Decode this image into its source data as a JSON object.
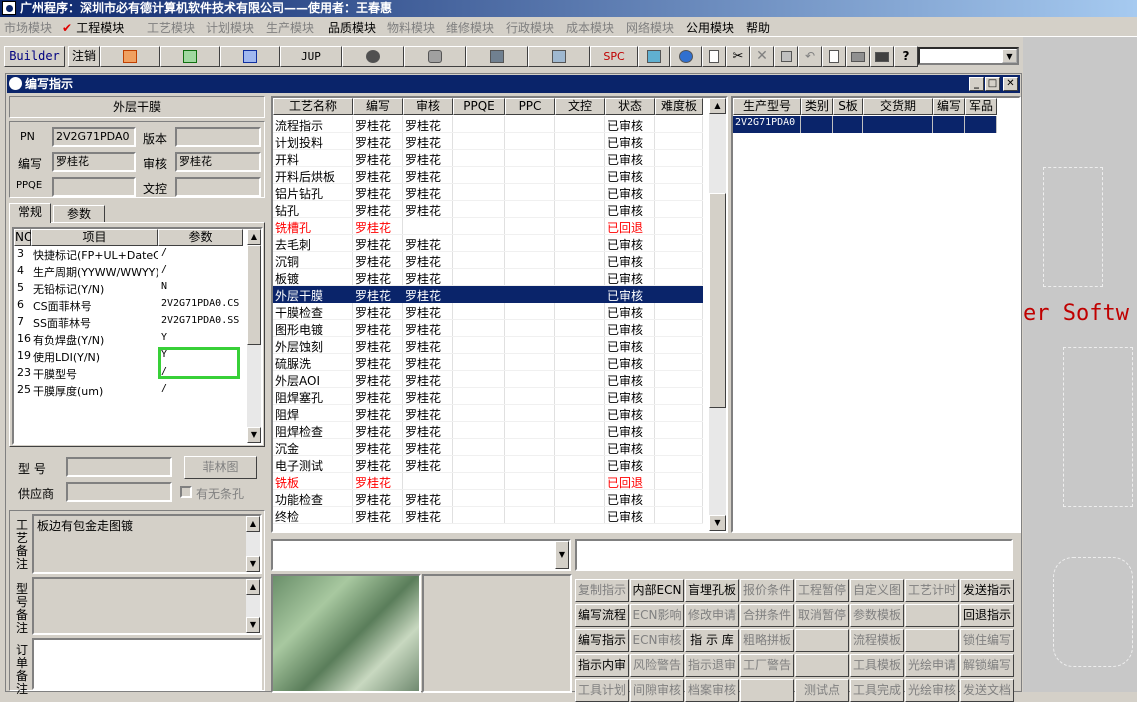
{
  "app_title": "广州程序：深圳市必有德计算机软件技术有限公司——使用者：王春惠",
  "menu": [
    {
      "label": "市场模块",
      "dim": true
    },
    {
      "label": "工程模块",
      "dim": false,
      "checked": true
    },
    {
      "label": "工艺模块",
      "dim": true
    },
    {
      "label": "计划模块",
      "dim": true
    },
    {
      "label": "生产模块",
      "dim": true
    },
    {
      "label": "品质模块",
      "dim": false
    },
    {
      "label": "物料模块",
      "dim": true
    },
    {
      "label": "维修模块",
      "dim": true
    },
    {
      "label": "行政模块",
      "dim": true
    },
    {
      "label": "成本模块",
      "dim": true
    },
    {
      "label": "网络模块",
      "dim": true
    },
    {
      "label": "公用模块",
      "dim": false
    },
    {
      "label": "帮助",
      "dim": false
    }
  ],
  "toolbar": {
    "builder": "Builder",
    "logout": "注销",
    "jup": "JUP",
    "spc": "SPC"
  },
  "bg_text": "er Softw",
  "window": {
    "title": "编写指示",
    "left": {
      "process_title": "外层干膜",
      "pn_label": "PN",
      "pn_value": "2V2G71PDA0",
      "version_label": "版本",
      "version_value": "",
      "author_label": "编写",
      "author_value": "罗桂花",
      "review_label": "审核",
      "review_value": "罗桂花",
      "ppqe_label": "PPQE",
      "ppqe_value": "",
      "wenkong_label": "文控",
      "wenkong_value": "",
      "tabs": [
        "常规",
        "参数"
      ],
      "param_headers": [
        "NO",
        "项目",
        "参数"
      ],
      "params": [
        {
          "no": "3",
          "item": "快捷标记(FP+UL+DateC",
          "val": "/"
        },
        {
          "no": "4",
          "item": "生产周期(YYWW/WWYY)",
          "val": "/"
        },
        {
          "no": "5",
          "item": "无铅标记(Y/N)",
          "val": "N"
        },
        {
          "no": "6",
          "item": "CS面菲林号",
          "val": "2V2G71PDA0.CS"
        },
        {
          "no": "7",
          "item": "SS面菲林号",
          "val": "2V2G71PDA0.SS"
        },
        {
          "no": "16",
          "item": "有负焊盘(Y/N)",
          "val": "Y"
        },
        {
          "no": "19",
          "item": "使用LDI(Y/N)",
          "val": "Y"
        },
        {
          "no": "23",
          "item": "干膜型号",
          "val": "/"
        },
        {
          "no": "25",
          "item": "干膜厚度(um)",
          "val": "/"
        }
      ],
      "model_label": "型  号",
      "model_value": "",
      "film_button": "菲林图",
      "supplier_label": "供应商",
      "supplier_value": "",
      "strip_label": "有无条孔",
      "craft_note_label": "工艺备注",
      "craft_note": "板边有包金走图镀",
      "model_note_label": "型号备注",
      "order_note_label": "订单备注"
    },
    "process_grid": {
      "headers": [
        "工艺名称",
        "编写",
        "审核",
        "PPQE",
        "PPC",
        "文控",
        "状态",
        "难度板"
      ],
      "rows": [
        {
          "name": "流程指示",
          "a": "罗桂花",
          "b": "罗桂花",
          "s": "已审核",
          "red": false,
          "sel": false
        },
        {
          "name": "计划投料",
          "a": "罗桂花",
          "b": "罗桂花",
          "s": "已审核",
          "red": false,
          "sel": false
        },
        {
          "name": "开料",
          "a": "罗桂花",
          "b": "罗桂花",
          "s": "已审核",
          "red": false,
          "sel": false
        },
        {
          "name": "开料后烘板",
          "a": "罗桂花",
          "b": "罗桂花",
          "s": "已审核",
          "red": false,
          "sel": false
        },
        {
          "name": "铝片钻孔",
          "a": "罗桂花",
          "b": "罗桂花",
          "s": "已审核",
          "red": false,
          "sel": false
        },
        {
          "name": "钻孔",
          "a": "罗桂花",
          "b": "罗桂花",
          "s": "已审核",
          "red": false,
          "sel": false
        },
        {
          "name": "铣槽孔",
          "a": "罗桂花",
          "b": "",
          "s": "已回退",
          "red": true,
          "sel": false
        },
        {
          "name": "去毛刺",
          "a": "罗桂花",
          "b": "罗桂花",
          "s": "已审核",
          "red": false,
          "sel": false
        },
        {
          "name": "沉铜",
          "a": "罗桂花",
          "b": "罗桂花",
          "s": "已审核",
          "red": false,
          "sel": false
        },
        {
          "name": "板镀",
          "a": "罗桂花",
          "b": "罗桂花",
          "s": "已审核",
          "red": false,
          "sel": false
        },
        {
          "name": "外层干膜",
          "a": "罗桂花",
          "b": "罗桂花",
          "s": "已审核",
          "red": false,
          "sel": true
        },
        {
          "name": "干膜检查",
          "a": "罗桂花",
          "b": "罗桂花",
          "s": "已审核",
          "red": false,
          "sel": false
        },
        {
          "name": "图形电镀",
          "a": "罗桂花",
          "b": "罗桂花",
          "s": "已审核",
          "red": false,
          "sel": false
        },
        {
          "name": "外层蚀刻",
          "a": "罗桂花",
          "b": "罗桂花",
          "s": "已审核",
          "red": false,
          "sel": false
        },
        {
          "name": "硫脲洗",
          "a": "罗桂花",
          "b": "罗桂花",
          "s": "已审核",
          "red": false,
          "sel": false
        },
        {
          "name": "外层AOI",
          "a": "罗桂花",
          "b": "罗桂花",
          "s": "已审核",
          "red": false,
          "sel": false
        },
        {
          "name": "阻焊塞孔",
          "a": "罗桂花",
          "b": "罗桂花",
          "s": "已审核",
          "red": false,
          "sel": false
        },
        {
          "name": "阻焊",
          "a": "罗桂花",
          "b": "罗桂花",
          "s": "已审核",
          "red": false,
          "sel": false
        },
        {
          "name": "阻焊检查",
          "a": "罗桂花",
          "b": "罗桂花",
          "s": "已审核",
          "red": false,
          "sel": false
        },
        {
          "name": "沉金",
          "a": "罗桂花",
          "b": "罗桂花",
          "s": "已审核",
          "red": false,
          "sel": false
        },
        {
          "name": "电子测试",
          "a": "罗桂花",
          "b": "罗桂花",
          "s": "已审核",
          "red": false,
          "sel": false
        },
        {
          "name": "铣板",
          "a": "罗桂花",
          "b": "",
          "s": "已回退",
          "red": true,
          "sel": false
        },
        {
          "name": "功能检查",
          "a": "罗桂花",
          "b": "罗桂花",
          "s": "已审核",
          "red": false,
          "sel": false
        },
        {
          "name": "终检",
          "a": "罗桂花",
          "b": "罗桂花",
          "s": "已审核",
          "red": false,
          "sel": false
        }
      ]
    },
    "product_grid": {
      "headers": [
        "生产型号",
        "类别",
        "S板",
        "交货期",
        "编写",
        "军品"
      ],
      "rows": [
        {
          "model": "2V2G71PDA0"
        }
      ]
    },
    "buttons": [
      [
        "复制指示",
        "内部ECN",
        "盲埋孔板",
        "报价条件",
        "工程暂停",
        "自定义图",
        "工艺计时",
        "发送指示"
      ],
      [
        "编写流程",
        "ECN影响",
        "修改申请",
        "合拼条件",
        "取消暂停",
        "参数模板",
        "",
        "回退指示"
      ],
      [
        "编写指示",
        "ECN审核",
        "指 示 库",
        "粗略拼板",
        "",
        "流程模板",
        "",
        "锁住编写"
      ],
      [
        "指示内审",
        "风险警告",
        "指示退审",
        "工厂警告",
        "",
        "工具模板",
        "光绘申请",
        "解锁编写"
      ],
      [
        "工具计划",
        "间隙审核",
        "档案审核",
        "",
        "测试点",
        "工具完成",
        "光绘审核",
        "发送文档"
      ]
    ],
    "buttons_dim": [
      [
        true,
        false,
        false,
        true,
        true,
        true,
        true,
        false
      ],
      [
        false,
        true,
        true,
        true,
        true,
        true,
        true,
        false
      ],
      [
        false,
        true,
        false,
        true,
        true,
        true,
        true,
        true
      ],
      [
        false,
        true,
        true,
        true,
        true,
        true,
        true,
        true
      ],
      [
        true,
        true,
        true,
        true,
        true,
        true,
        true,
        true
      ]
    ]
  }
}
